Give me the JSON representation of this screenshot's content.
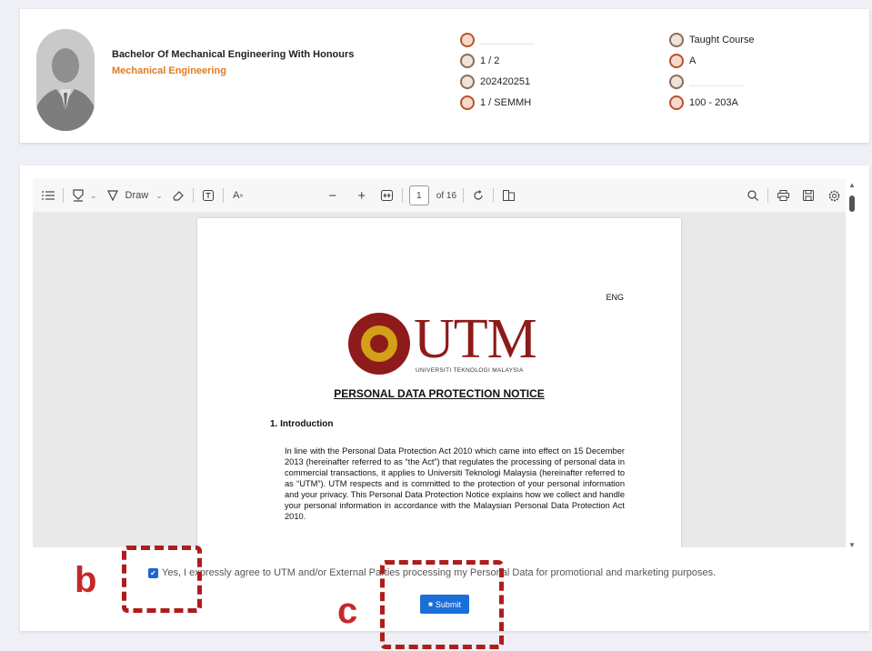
{
  "profile": {
    "program": "Bachelor Of Mechanical Engineering With Honours",
    "department": "Mechanical Engineering",
    "col1": [
      "",
      "1 / 2",
      "202420251",
      "1 / SEMMH"
    ],
    "col2": [
      "Taught Course",
      "A",
      "",
      "100 - 203A"
    ]
  },
  "toolbar": {
    "draw_label": "Draw",
    "page_current": "1",
    "page_total": "of 16"
  },
  "document": {
    "lang": "ENG",
    "brand": "UTM",
    "brand_sub": "UNIVERSITI TEKNOLOGI MALAYSIA",
    "title": "PERSONAL DATA PROTECTION NOTICE",
    "section_heading": "1.  Introduction",
    "paragraph": "In line with the Personal Data Protection Act 2010 which came into effect on 15 December 2013 (hereinafter referred to as “the Act”) that regulates the processing of personal data in commercial transactions, it applies to Universiti Teknologi Malaysia (hereinafter referred to as “UTM”). UTM respects and is committed to the protection of your personal information and your privacy. This Personal Data Protection Notice explains how we collect and handle your personal information in accordance with the Malaysian Personal Data Protection Act 2010."
  },
  "consent": {
    "checked": true,
    "text": "Yes, I expressly agree to UTM and/or External Parties processing my Personal Data for promotional and marketing purposes."
  },
  "submit": {
    "label": "Submit"
  },
  "annotations": {
    "b": "b",
    "c": "c"
  },
  "colors": {
    "accent": "#1b6fd9",
    "annotation": "#b01c1c",
    "department": "#e07b22",
    "brand": "#8e1b1b"
  }
}
